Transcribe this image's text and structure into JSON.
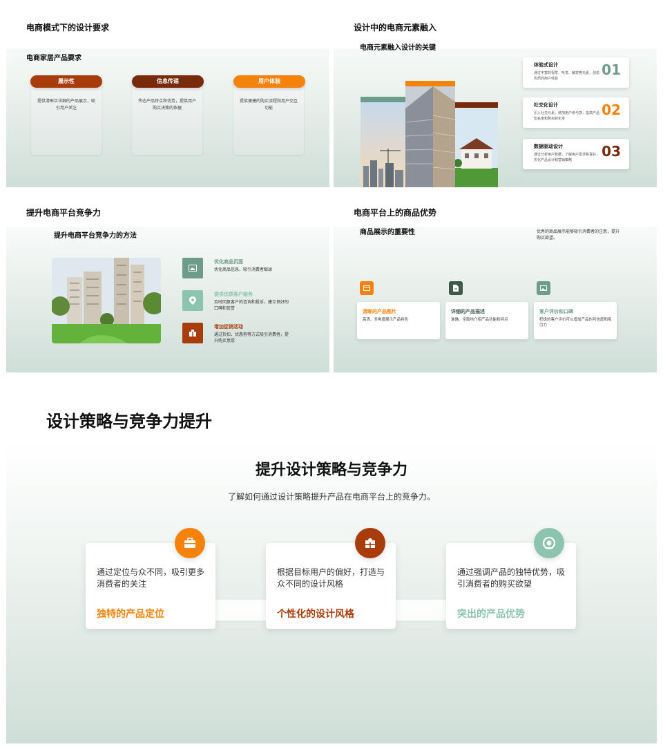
{
  "slide1": {
    "heading": "电商模式下的设计要求",
    "subtitle": "电商家居产品要求",
    "items": [
      {
        "label": "展示性",
        "desc": "提供清晰且详细的产品展示，吸引用户关注",
        "color": "#a83c0b"
      },
      {
        "label": "信息传递",
        "desc": "传达产品特点和优势，提供用户购买决策的依据",
        "color": "#7a2a0c"
      },
      {
        "label": "用户体验",
        "desc": "提供便捷的购买流程和用户交互功能",
        "color": "#f5820a"
      }
    ]
  },
  "slide2": {
    "heading": "设计中的电商元素融入",
    "subtitle": "电商元素融入设计的关键",
    "features": [
      {
        "title": "体验式设计",
        "desc": "通过丰富的视觉、听觉、触觉等元素，创造优质的用户体验",
        "num": "01",
        "color": "#6e9c8c"
      },
      {
        "title": "社交化设计",
        "desc": "引入社交元素，增加用户参与感，提高产品知名度和购买转化率",
        "num": "02",
        "color": "#f5820a"
      },
      {
        "title": "数据驱动设计",
        "desc": "通过分析用户数据，了解用户需求和喜好，优化产品设计和营销策略",
        "num": "03",
        "color": "#7a2a0c"
      }
    ]
  },
  "slide3": {
    "heading": "提升电商平台竞争力",
    "subtitle": "提升电商平台竞争力的方法",
    "items": [
      {
        "title": "优化商品页面",
        "desc": "优化商品信息、吸引消费者眼球",
        "color": "#6e9c8c"
      },
      {
        "title": "提供优质客户服务",
        "desc": "及时回复客户的咨询和投诉，建立良好的口碑和信誉",
        "color": "#8cc4b0"
      },
      {
        "title": "增加促销活动",
        "desc": "通过折扣、优惠券等方式吸引消费者，提升购买意愿",
        "color": "#a83c0b"
      }
    ]
  },
  "slide4": {
    "heading": "电商平台上的商品优势",
    "subtitle": "商品展示的重要性",
    "note": "优秀的商品展示能够吸引消费者的注意，提升购买欲望。",
    "cards": [
      {
        "title": "清晰的产品图片",
        "desc": "高清、多角度展示产品特色",
        "color": "#f5820a"
      },
      {
        "title": "详细的产品描述",
        "desc": "准确、全面地介绍产品功能和特点",
        "color": "#3d5a48"
      },
      {
        "title": "客户评价和口碑",
        "desc": "积极的客户评价可以增加产品的可信度和吸引力",
        "color": "#6e9c8c"
      }
    ]
  },
  "slide5": {
    "heading": "设计策略与竞争力提升",
    "title": "提升设计策略与竞争力",
    "subtitle": "了解如何通过设计策略提升产品在电商平台上的竞争力。",
    "cards": [
      {
        "desc": "通过定位与众不同，吸引更多消费者的关注",
        "title": "独特的产品定位",
        "color": "#f5820a"
      },
      {
        "desc": "根据目标用户的偏好，打造与众不同的设计风格",
        "title": "个性化的设计风格",
        "color": "#a83c0b"
      },
      {
        "desc": "通过强调产品的独特优势，吸引消费者的购买欲望",
        "title": "突出的产品优势",
        "color": "#8cc4b0"
      }
    ]
  }
}
